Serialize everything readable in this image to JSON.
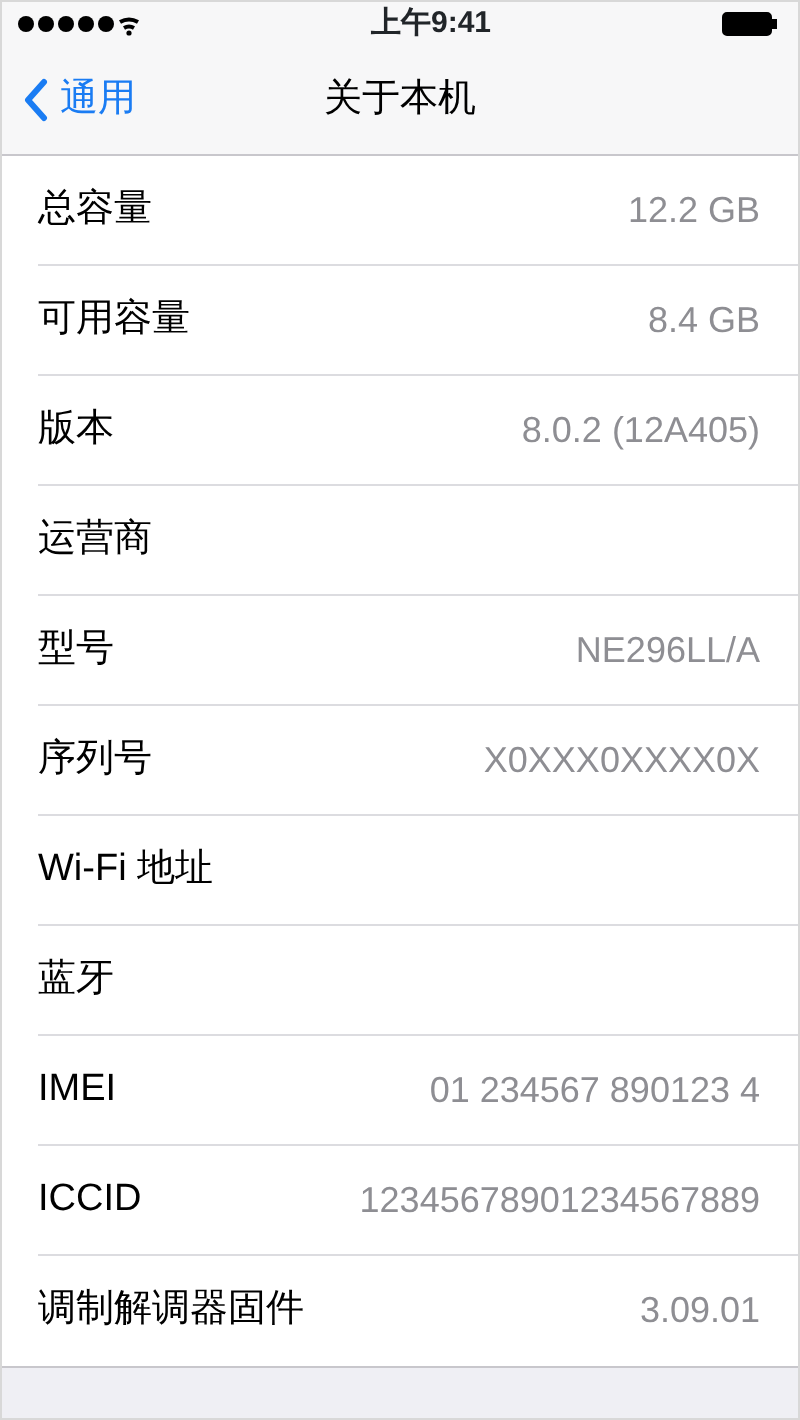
{
  "status_bar": {
    "time": "上午9:41"
  },
  "nav": {
    "back": "通用",
    "title": "关于本机"
  },
  "rows": [
    {
      "label": "总容量",
      "value": "12.2 GB"
    },
    {
      "label": "可用容量",
      "value": "8.4 GB"
    },
    {
      "label": "版本",
      "value": "8.0.2 (12A405)"
    },
    {
      "label": "运营商"
    },
    {
      "label": "型号",
      "value": "NE296LL/A"
    },
    {
      "label": "序列号",
      "value": "X0XXX0XXXX0X"
    },
    {
      "label": "Wi-Fi 地址"
    },
    {
      "label": "蓝牙"
    },
    {
      "label": "IMEI",
      "value": "01 234567 890123 4"
    },
    {
      "label": "ICCID",
      "value": "12345678901234567889"
    },
    {
      "label": "调制解调器固件",
      "value": "3.09.01"
    }
  ]
}
